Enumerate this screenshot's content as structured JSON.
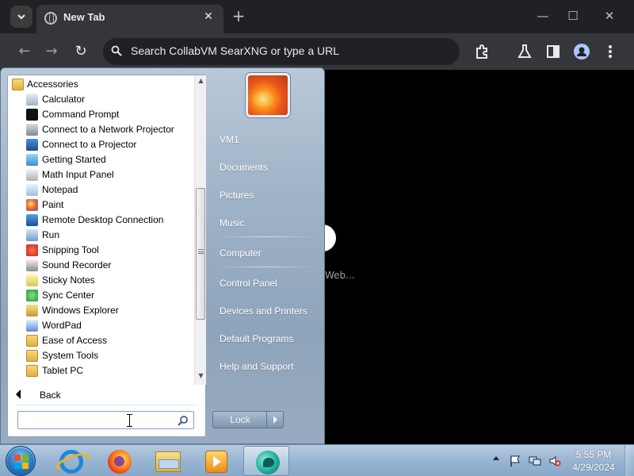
{
  "browser": {
    "tab": {
      "title": "New Tab",
      "icon": "globe-icon"
    },
    "window_controls": {
      "minimize": "—",
      "maximize": "☐",
      "close": "✕"
    },
    "omnibox": {
      "placeholder": "Search CollabVM SearXNG or type a URL"
    },
    "toolbar_icons": [
      "extensions-icon",
      "labs-icon",
      "side-panel-icon",
      "profile-icon",
      "menu-icon"
    ],
    "page": {
      "text": "Web..."
    }
  },
  "start_menu": {
    "programs": [
      {
        "label": "Accessories",
        "icon": "folder-icon"
      },
      {
        "label": "Calculator",
        "icon": "calculator-icon"
      },
      {
        "label": "Command Prompt",
        "icon": "command-prompt-icon"
      },
      {
        "label": "Connect to a Network Projector",
        "icon": "network-projector-icon"
      },
      {
        "label": "Connect to a Projector",
        "icon": "projector-icon"
      },
      {
        "label": "Getting Started",
        "icon": "getting-started-icon"
      },
      {
        "label": "Math Input Panel",
        "icon": "math-input-icon"
      },
      {
        "label": "Notepad",
        "icon": "notepad-icon"
      },
      {
        "label": "Paint",
        "icon": "paint-icon"
      },
      {
        "label": "Remote Desktop Connection",
        "icon": "remote-desktop-icon"
      },
      {
        "label": "Run",
        "icon": "run-icon"
      },
      {
        "label": "Snipping Tool",
        "icon": "snipping-tool-icon"
      },
      {
        "label": "Sound Recorder",
        "icon": "sound-recorder-icon"
      },
      {
        "label": "Sticky Notes",
        "icon": "sticky-notes-icon"
      },
      {
        "label": "Sync Center",
        "icon": "sync-center-icon"
      },
      {
        "label": "Windows Explorer",
        "icon": "windows-explorer-icon"
      },
      {
        "label": "WordPad",
        "icon": "wordpad-icon"
      },
      {
        "label": "Ease of Access",
        "icon": "folder-icon"
      },
      {
        "label": "System Tools",
        "icon": "folder-icon"
      },
      {
        "label": "Tablet PC",
        "icon": "folder-icon"
      }
    ],
    "back_label": "Back",
    "search": {
      "value": ""
    },
    "right_items": {
      "user": "VM1",
      "documents": "Documents",
      "pictures": "Pictures",
      "music": "Music",
      "computer": "Computer",
      "control_panel": "Control Panel",
      "devices": "Devices and Printers",
      "default_programs": "Default Programs",
      "help": "Help and Support"
    },
    "lock_label": "Lock"
  },
  "taskbar": {
    "apps": [
      "internet-explorer-icon",
      "firefox-icon",
      "windows-explorer-icon",
      "media-player-icon",
      "remote-viewer-icon"
    ],
    "clock": {
      "time": "5:55 PM",
      "date": "4/29/2024"
    }
  }
}
